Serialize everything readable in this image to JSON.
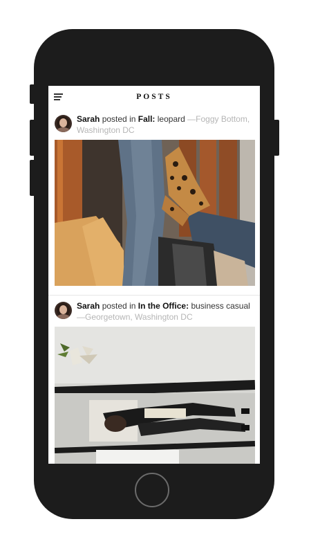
{
  "header": {
    "title": "POSTS",
    "menu_icon": "hamburger-menu-icon"
  },
  "posts": [
    {
      "author": "Sarah",
      "verb": "posted in",
      "category": "Fall:",
      "caption": "leopard",
      "separator": " —",
      "location": "Foggy Bottom, Washington DC"
    },
    {
      "author": "Sarah",
      "verb": "posted in",
      "category": "In the Office:",
      "caption": "business casual",
      "separator": " —",
      "location": "Georgetown, Washington DC"
    }
  ],
  "colors": {
    "phone_body": "#1c1c1c",
    "screen_bg": "#ffffff",
    "location_text": "#b5b5b5"
  }
}
